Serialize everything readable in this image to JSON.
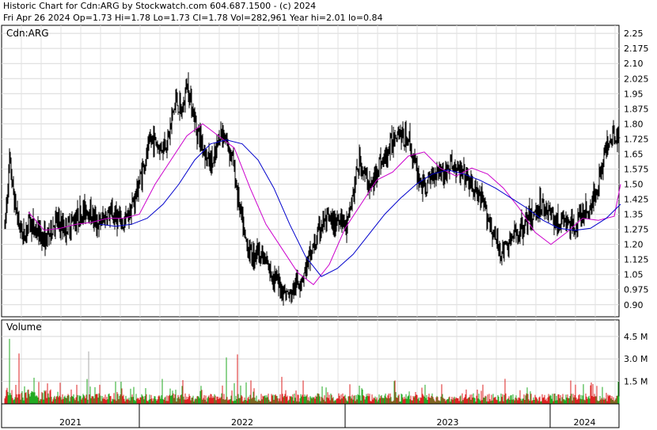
{
  "header": {
    "line1": "Historic Chart for Cdn:ARG by Stockwatch.com 604.687.1500 - (c) 2024",
    "line2": "Fri Apr 26 2024   Op=1.73  Hi=1.78  Lo=1.73  Cl=1.78  Vol=282,961  Year hi=2.01  lo=0.84"
  },
  "chart_data": [
    {
      "type": "line",
      "title": "Cdn:ARG",
      "ylim": [
        0.84,
        2.29
      ],
      "yticks": [
        "2.25",
        "2.175",
        "2.10",
        "2.025",
        "1.95",
        "1.875",
        "1.80",
        "1.725",
        "1.65",
        "1.575",
        "1.50",
        "1.425",
        "1.35",
        "1.275",
        "1.20",
        "1.125",
        "1.05",
        "0.975",
        "0.90"
      ],
      "x_ticks": [
        "2021",
        "2022",
        "2023",
        "2024"
      ],
      "grid": true,
      "colors": {
        "price": "#000000",
        "ma_short": "#cc00cc",
        "ma_long": "#0000cc"
      },
      "series": [
        {
          "name": "price",
          "x": [
            0,
            6,
            12,
            18,
            24,
            30,
            40,
            52,
            64,
            76,
            90,
            104,
            118,
            130,
            140,
            150,
            158,
            166,
            176,
            186,
            196,
            206,
            216,
            224,
            230,
            236,
            242,
            248,
            256,
            264,
            272,
            280,
            288,
            296,
            304,
            312,
            320,
            330,
            340,
            350,
            360,
            368,
            374,
            380,
            386,
            392,
            400,
            408,
            416,
            424,
            432,
            440,
            448,
            456,
            464,
            472,
            480,
            488,
            496,
            504,
            510,
            516,
            524,
            532,
            540,
            548,
            556,
            564,
            572,
            580,
            588,
            596,
            604,
            612,
            620,
            628,
            636,
            644,
            652,
            660,
            668,
            676,
            684,
            692,
            700,
            708,
            716,
            724,
            732,
            740,
            748,
            756,
            764,
            770,
            776
          ],
          "y": [
            1.28,
            1.62,
            1.42,
            1.3,
            1.24,
            1.31,
            1.27,
            1.22,
            1.32,
            1.28,
            1.33,
            1.38,
            1.3,
            1.35,
            1.34,
            1.3,
            1.36,
            1.45,
            1.6,
            1.73,
            1.68,
            1.72,
            1.92,
            1.85,
            2.0,
            1.9,
            1.78,
            1.72,
            1.62,
            1.6,
            1.76,
            1.72,
            1.62,
            1.4,
            1.22,
            1.14,
            1.18,
            1.1,
            1.04,
            0.98,
            0.94,
            1.0,
            1.03,
            1.08,
            1.15,
            1.2,
            1.3,
            1.32,
            1.3,
            1.35,
            1.28,
            1.45,
            1.62,
            1.53,
            1.48,
            1.6,
            1.62,
            1.7,
            1.78,
            1.72,
            1.74,
            1.62,
            1.52,
            1.48,
            1.55,
            1.58,
            1.55,
            1.6,
            1.56,
            1.55,
            1.5,
            1.45,
            1.4,
            1.32,
            1.22,
            1.16,
            1.2,
            1.24,
            1.28,
            1.32,
            1.34,
            1.4,
            1.38,
            1.34,
            1.3,
            1.32,
            1.28,
            1.32,
            1.36,
            1.38,
            1.48,
            1.62,
            1.74,
            1.76,
            1.72
          ]
        },
        {
          "name": "ma_short",
          "x": [
            30,
            50,
            70,
            90,
            110,
            130,
            150,
            170,
            190,
            210,
            230,
            250,
            270,
            290,
            310,
            330,
            350,
            370,
            390,
            410,
            430,
            450,
            470,
            490,
            510,
            530,
            550,
            570,
            590,
            610,
            630,
            650,
            670,
            690,
            710,
            730,
            750,
            770,
            778
          ],
          "y": [
            1.36,
            1.27,
            1.28,
            1.3,
            1.31,
            1.33,
            1.33,
            1.35,
            1.5,
            1.62,
            1.74,
            1.8,
            1.74,
            1.68,
            1.48,
            1.3,
            1.18,
            1.06,
            1.0,
            1.1,
            1.28,
            1.4,
            1.52,
            1.56,
            1.64,
            1.66,
            1.58,
            1.54,
            1.58,
            1.55,
            1.48,
            1.38,
            1.26,
            1.2,
            1.26,
            1.33,
            1.32,
            1.34,
            1.5
          ]
        },
        {
          "name": "ma_long",
          "x": [
            120,
            140,
            160,
            180,
            200,
            220,
            240,
            260,
            280,
            300,
            320,
            340,
            360,
            380,
            400,
            420,
            440,
            460,
            480,
            500,
            520,
            540,
            560,
            580,
            600,
            620,
            640,
            660,
            680,
            700,
            720,
            740,
            760,
            778
          ],
          "y": [
            1.3,
            1.29,
            1.3,
            1.33,
            1.4,
            1.5,
            1.62,
            1.7,
            1.72,
            1.7,
            1.62,
            1.48,
            1.3,
            1.14,
            1.04,
            1.08,
            1.15,
            1.25,
            1.35,
            1.43,
            1.5,
            1.55,
            1.57,
            1.55,
            1.52,
            1.48,
            1.43,
            1.38,
            1.32,
            1.28,
            1.27,
            1.28,
            1.33,
            1.4
          ]
        }
      ]
    },
    {
      "type": "bar",
      "title": "Volume",
      "ylim": [
        0,
        5.6
      ],
      "yticks": [
        "4.5 M",
        "3.0 M",
        "1.5 M"
      ],
      "ytick_values": [
        4.5,
        3.0,
        1.5
      ],
      "colors": {
        "up": "#22aa22",
        "down": "#dd2222",
        "neutral": "#aaaaaa"
      },
      "spikes": [
        {
          "x": 6,
          "v": 3.1
        },
        {
          "x": 18,
          "v": 2.4
        },
        {
          "x": 106,
          "v": 3.5
        },
        {
          "x": 280,
          "v": 3.1
        },
        {
          "x": 294,
          "v": 3.3
        },
        {
          "x": 350,
          "v": 1.8
        },
        {
          "x": 748,
          "v": 1.2
        }
      ]
    }
  ]
}
